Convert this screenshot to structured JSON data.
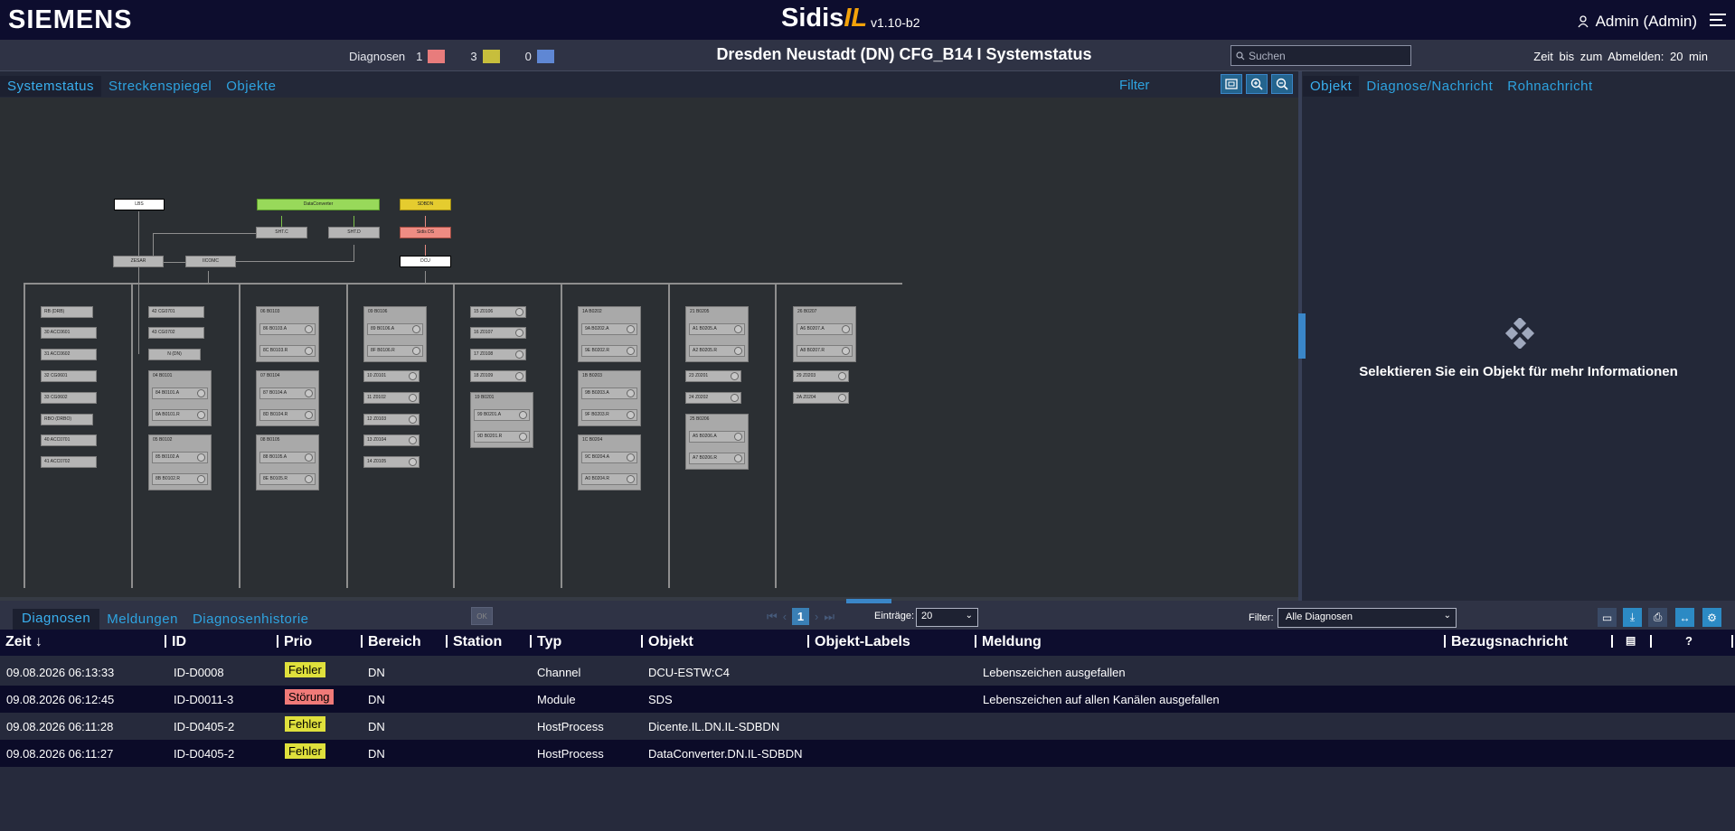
{
  "header": {
    "logo": "SIEMENS",
    "app_name": "Sidis",
    "app_name_suffix": "IL",
    "version": "v1.10-b2",
    "user": "Admin (Admin)"
  },
  "subheader": {
    "diag_label": "Diagnosen",
    "counts": [
      {
        "value": "1",
        "color": "#e87c7c"
      },
      {
        "value": "3",
        "color": "#c7be3c"
      },
      {
        "value": "0",
        "color": "#5f87d4"
      }
    ],
    "title": "Dresden Neustadt (DN) CFG_B14 I Systemstatus",
    "search_placeholder": "Suchen",
    "timeout": "Zeit bis zum Abmelden: 20 min"
  },
  "left_tabs": [
    "Systemstatus",
    "Streckenspiegel",
    "Objekte"
  ],
  "filter_label": "Filter",
  "right_tabs": [
    "Objekt",
    "Diagnose/Nachricht",
    "Rohnachricht"
  ],
  "right_message": "Selektieren Sie ein Objekt für mehr Informationen",
  "diagram": {
    "top": {
      "lbs": "LBS",
      "dataconverter": "DataConverter",
      "sdbdn": "SDBDN",
      "shtc": "SHT.C",
      "shtd": "SHT.D",
      "sidisds": "Sidis DS",
      "zesar": "ZESAR",
      "iicomc": "IICOMC",
      "dcu": "DCU"
    },
    "col1": [
      "RB (DRB)",
      "30   ACC0601",
      "31   ACC0602",
      "32   CG0601",
      "33   CG0602",
      "RBO (DRBO)",
      "40   ACC0701",
      "41   ACC0702"
    ],
    "col2": {
      "a": "42   CG0701",
      "b": "43   CG0702",
      "c": "N (DN)",
      "g1": {
        "t": "04  B0101",
        "i": [
          "84   B0101.A",
          "8A   B0101.R"
        ]
      },
      "g2": {
        "t": "05  B0102",
        "i": [
          "85   B0102.A",
          "8B   B0102.R"
        ]
      }
    },
    "col3": [
      {
        "t": "06  B0103",
        "i": [
          "86   B0103.A",
          "8C   B0103.R"
        ]
      },
      {
        "t": "07  B0104",
        "i": [
          "87   B0104.A",
          "8D   B0104.R"
        ]
      },
      {
        "t": "08  B0105",
        "i": [
          "88   B0105.A",
          "8E   B0105.R"
        ]
      }
    ],
    "col4": {
      "g": {
        "t": "09  B0106",
        "i": [
          "89   B0106.A",
          "8F   B0106.R"
        ]
      },
      "z": [
        "10   Z0101",
        "11   Z0102",
        "12   Z0103",
        "13   Z0104",
        "14   Z0105"
      ]
    },
    "col5": {
      "z": [
        "15   Z0106",
        "16   Z0107",
        "17   Z0108",
        "18   Z0109"
      ],
      "g": {
        "t": "19  B0201",
        "i": [
          "99   B0201.A",
          "9D   B0201.R"
        ]
      }
    },
    "col6": [
      {
        "t": "1A  B0202",
        "i": [
          "9A   B0202.A",
          "9E   B0202.R"
        ]
      },
      {
        "t": "1B  B0203",
        "i": [
          "9B   B0203.A",
          "9F   B0203.R"
        ]
      },
      {
        "t": "1C  B0204",
        "i": [
          "9C   B0204.A",
          "A0   B0204.R"
        ]
      }
    ],
    "col7": {
      "g1": {
        "t": "21  B0205",
        "i": [
          "A1   B0205.A",
          "A2   B0205.R"
        ]
      },
      "z": [
        "23   Z0201",
        "24   Z0202"
      ],
      "g2": {
        "t": "25  B0206",
        "i": [
          "A5   B0206.A",
          "A7   B0206.R"
        ]
      }
    },
    "col8": {
      "g": {
        "t": "26  B0207",
        "i": [
          "A6   B0207.A",
          "A8   B0207.R"
        ]
      },
      "z": [
        "29   Z0203",
        "2A   Z0204"
      ]
    }
  },
  "bottom_tabs": [
    "Diagnosen",
    "Meldungen",
    "Diagnosenhistorie"
  ],
  "ok_label": "OK",
  "pagination": {
    "current": "1",
    "entries_label": "Einträge:",
    "page_size": "20"
  },
  "filter": {
    "label": "Filter:",
    "value": "Alle Diagnosen"
  },
  "table": {
    "headers": {
      "zeit": "Zeit",
      "id": "ID",
      "prio": "Prio",
      "bereich": "Bereich",
      "station": "Station",
      "typ": "Typ",
      "objekt": "Objekt",
      "labels": "Objekt-Labels",
      "meldung": "Meldung",
      "bezug": "Bezugsnachricht",
      "help": "?"
    },
    "rows": [
      {
        "zeit": "09.08.2026  06:13:33",
        "id": "ID-D0008",
        "prio": "Fehler",
        "prio_color": "#dfe03c",
        "bereich": "DN",
        "typ": "Channel",
        "objekt": "DCU-ESTW:C4",
        "meldung": "Lebenszeichen  ausgefallen"
      },
      {
        "zeit": "09.08.2026  06:12:45",
        "id": "ID-D0011-3",
        "prio": "Störung",
        "prio_color": "#f07a78",
        "bereich": "DN",
        "typ": "Module",
        "objekt": "SDS",
        "meldung": "Lebenszeichen  auf  allen  Kanälen  ausgefallen"
      },
      {
        "zeit": "09.08.2026  06:11:28",
        "id": "ID-D0405-2",
        "prio": "Fehler",
        "prio_color": "#dfe03c",
        "bereich": "DN",
        "typ": "HostProcess",
        "objekt": "Dicente.IL.DN.IL-SDBDN",
        "meldung": ""
      },
      {
        "zeit": "09.08.2026  06:11:27",
        "id": "ID-D0405-2",
        "prio": "Fehler",
        "prio_color": "#dfe03c",
        "bereich": "DN",
        "typ": "HostProcess",
        "objekt": "DataConverter.DN.IL-SDBDN",
        "meldung": ""
      }
    ]
  }
}
